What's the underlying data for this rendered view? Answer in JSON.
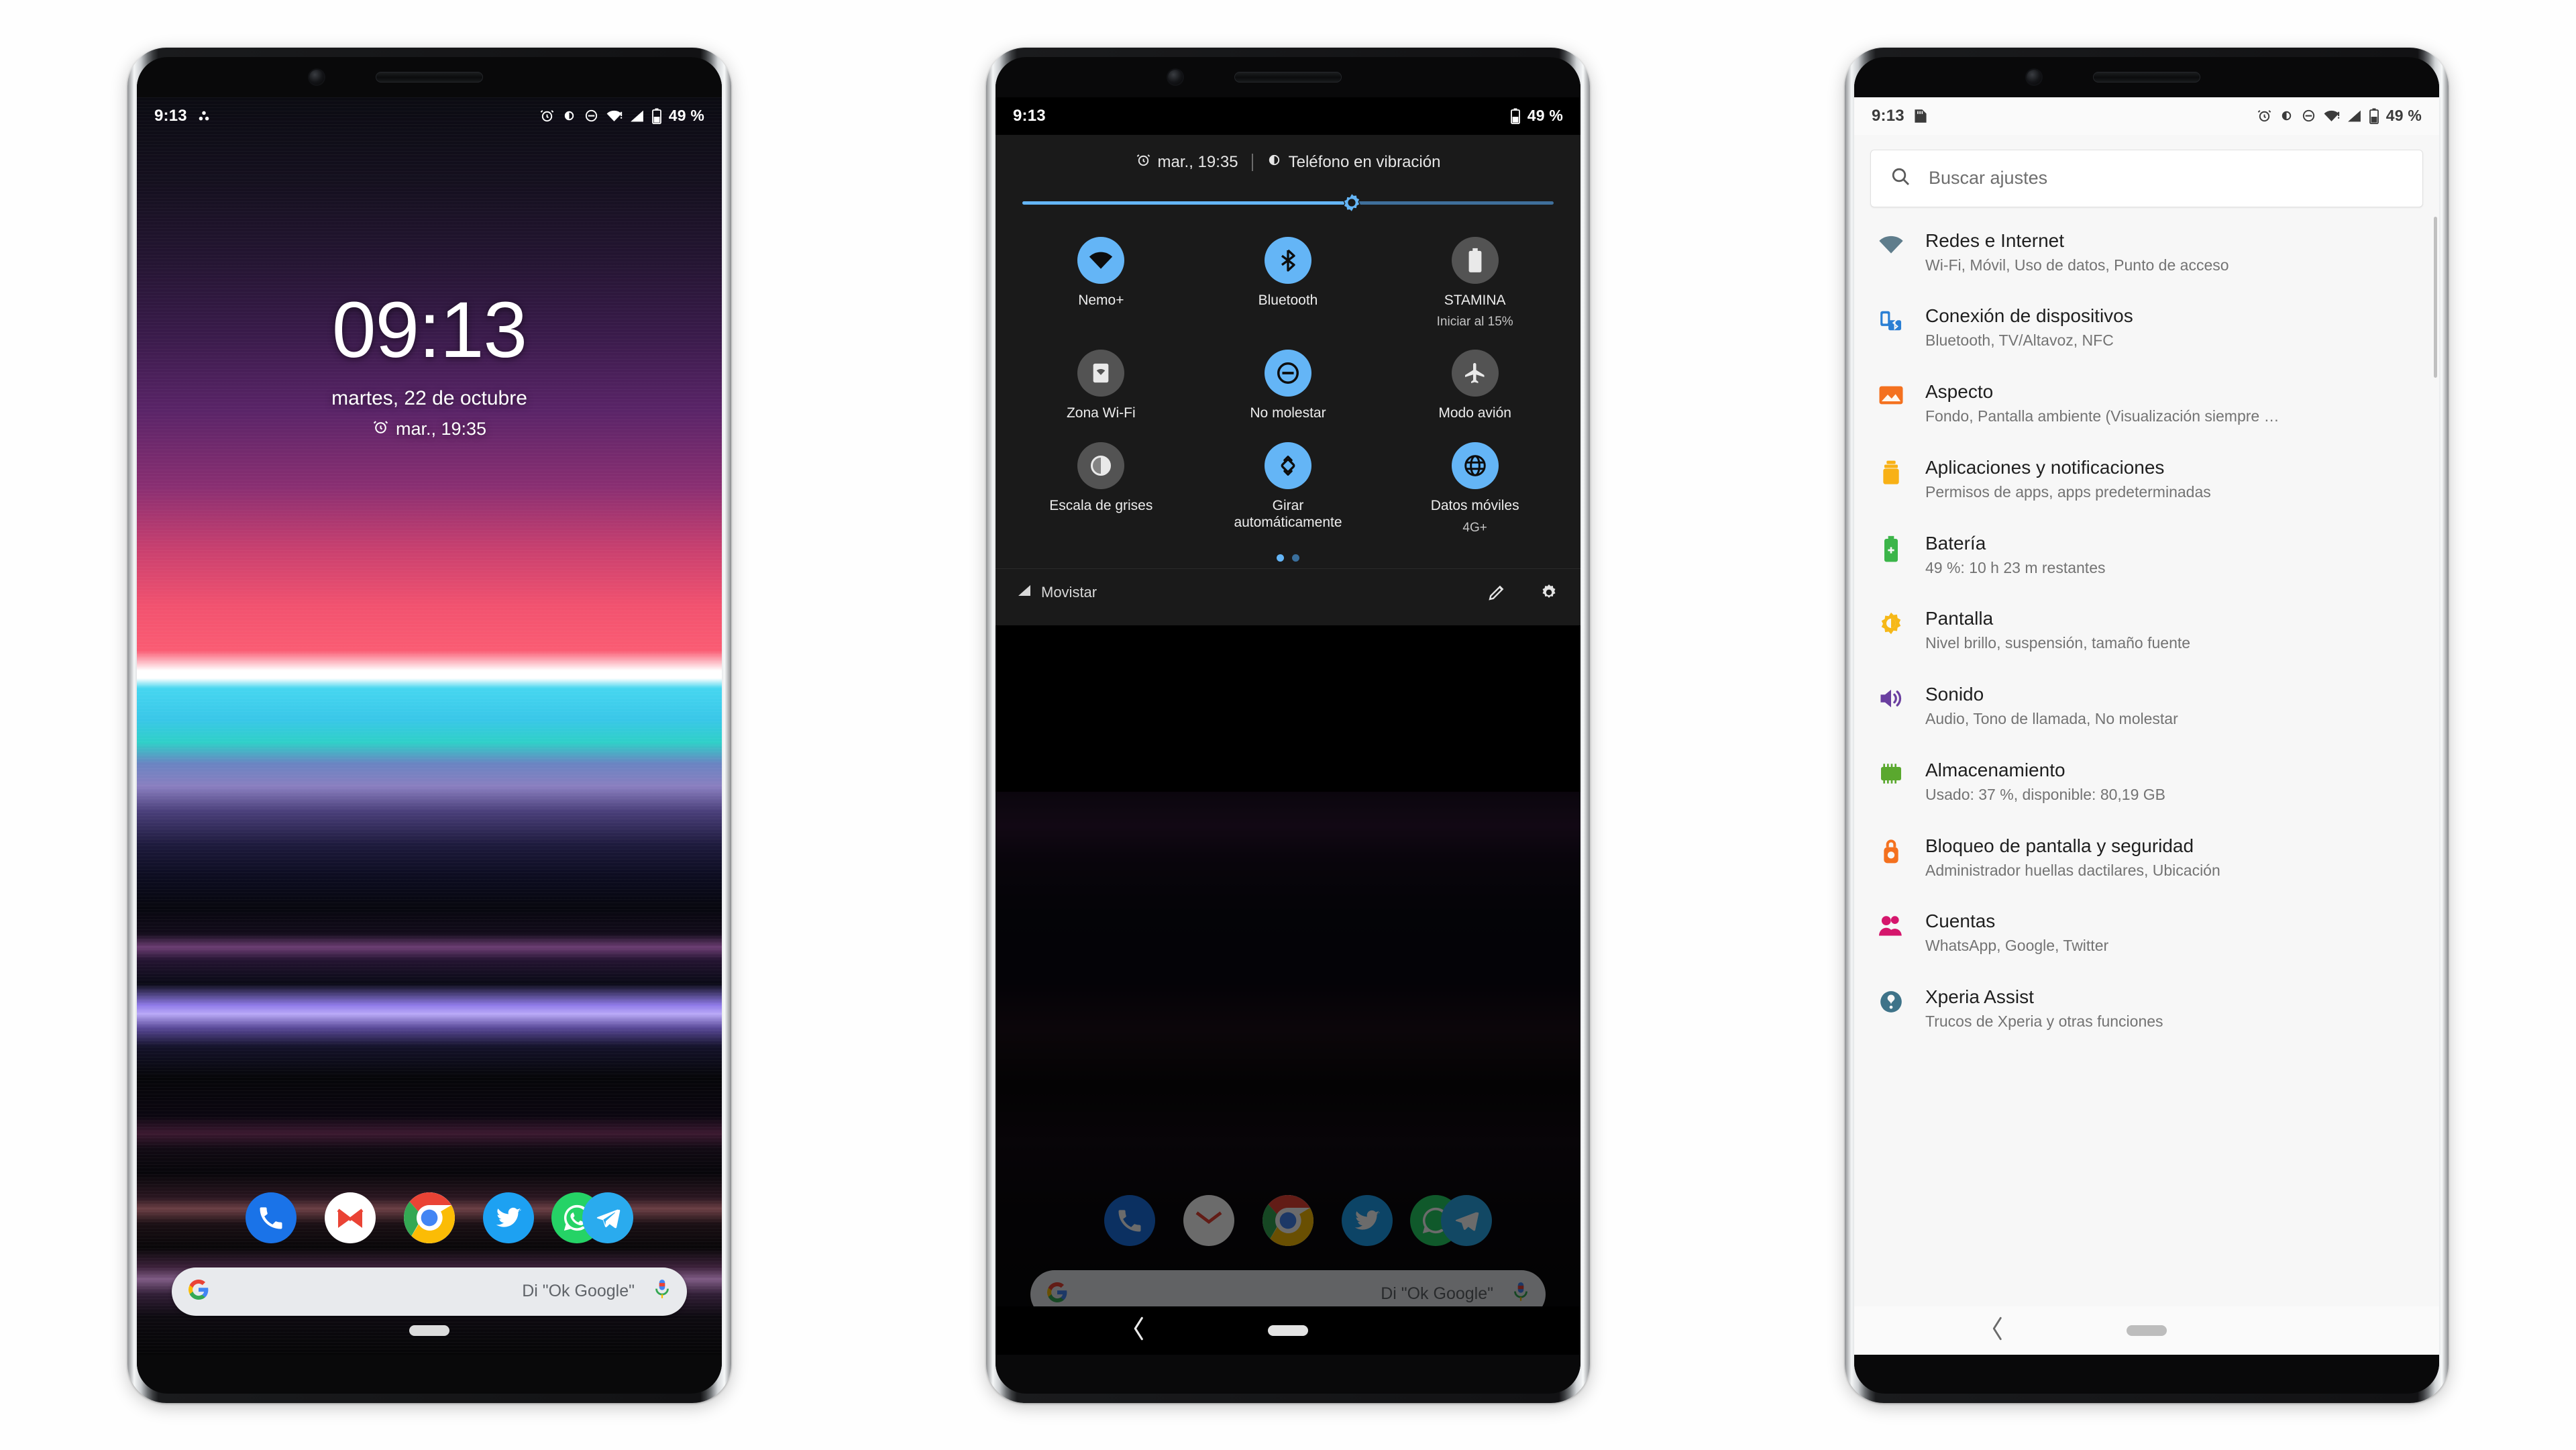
{
  "statusbar": {
    "time": "9:13",
    "battery_pct": "49 %",
    "icons": [
      "alarm-icon",
      "brightness-icon",
      "do-not-disturb-icon",
      "wifi-icon",
      "signal-icon",
      "battery-icon"
    ]
  },
  "phone1": {
    "name": "lock-screen",
    "status_time": "9:13",
    "status_battery": "49 %",
    "clock": "09:13",
    "date": "martes, 22 de octubre",
    "alarm": "mar., 19:35",
    "dock": [
      {
        "name": "phone-app",
        "label": "Teléfono"
      },
      {
        "name": "gmail-app",
        "label": "Gmail"
      },
      {
        "name": "chrome-app",
        "label": "Chrome"
      },
      {
        "name": "twitter-app",
        "label": "Twitter"
      },
      {
        "name": "whatsapp-app",
        "label": "WhatsApp"
      },
      {
        "name": "telegram-app",
        "label": "Telegram"
      }
    ],
    "search_hint": "Di \"Ok Google\""
  },
  "phone2": {
    "name": "quick-settings",
    "status_time": "9:13",
    "status_battery": "49 %",
    "header_alarm": "mar., 19:35",
    "header_ring": "Teléfono en vibración",
    "brightness_pct": 62,
    "tiles": [
      {
        "label": "Nemo+",
        "sub": "",
        "state": "on",
        "icon": "wifi-icon"
      },
      {
        "label": "Bluetooth",
        "sub": "",
        "state": "on",
        "icon": "bluetooth-icon"
      },
      {
        "label": "STAMINA",
        "sub": "Iniciar al 15%",
        "state": "off",
        "icon": "battery-icon"
      },
      {
        "label": "Zona Wi-Fi",
        "sub": "",
        "state": "off",
        "icon": "hotspot-icon"
      },
      {
        "label": "No molestar",
        "sub": "",
        "state": "on",
        "icon": "do-not-disturb-icon"
      },
      {
        "label": "Modo avión",
        "sub": "",
        "state": "off",
        "icon": "airplane-icon"
      },
      {
        "label": "Escala de grises",
        "sub": "",
        "state": "off",
        "icon": "grayscale-icon"
      },
      {
        "label": "Girar automáticamente",
        "sub": "",
        "state": "on",
        "icon": "auto-rotate-icon"
      },
      {
        "label": "Datos móviles",
        "sub": "4G+",
        "state": "on",
        "icon": "globe-icon"
      }
    ],
    "page_dots": {
      "count": 2,
      "active": 0
    },
    "carrier": "Movistar",
    "footer_icons": [
      "edit-pencil-icon",
      "gear-icon"
    ],
    "search_hint": "Di \"Ok Google\""
  },
  "phone3": {
    "name": "settings-app",
    "status_time": "9:13",
    "status_battery": "49 %",
    "search_placeholder": "Buscar ajustes",
    "items": [
      {
        "title": "Redes e Internet",
        "sub": "Wi-Fi, Móvil, Uso de datos, Punto de acceso",
        "icon": "wifi-icon",
        "color": "#5f7d8c"
      },
      {
        "title": "Conexión de dispositivos",
        "sub": "Bluetooth, TV/Altavoz, NFC",
        "icon": "devices-icon",
        "color": "#2a7fd4"
      },
      {
        "title": "Aspecto",
        "sub": "Fondo, Pantalla ambiente (Visualización siempre …",
        "icon": "wallpaper-icon",
        "color": "#f4711f"
      },
      {
        "title": "Aplicaciones y notificaciones",
        "sub": "Permisos de apps, apps predeterminadas",
        "icon": "apps-icon",
        "color": "#f8b116"
      },
      {
        "title": "Batería",
        "sub": "49 %: 10 h  23 m restantes",
        "icon": "battery-icon",
        "color": "#3cb54a"
      },
      {
        "title": "Pantalla",
        "sub": "Nivel brillo, suspensión, tamaño fuente",
        "icon": "brightness-icon",
        "color": "#f6b818"
      },
      {
        "title": "Sonido",
        "sub": "Audio, Tono de llamada, No molestar",
        "icon": "volume-icon",
        "color": "#6a3fa0"
      },
      {
        "title": "Almacenamiento",
        "sub": "Usado: 37 %, disponible: 80,19 GB",
        "icon": "storage-icon",
        "color": "#5aa82e"
      },
      {
        "title": "Bloqueo de pantalla y seguridad",
        "sub": "Administrador huellas dactilares, Ubicación",
        "icon": "lock-icon",
        "color": "#f4711f"
      },
      {
        "title": "Cuentas",
        "sub": "WhatsApp, Google, Twitter",
        "icon": "accounts-icon",
        "color": "#d5166c"
      },
      {
        "title": "Xperia Assist",
        "sub": "Trucos de Xperia y otras funciones",
        "icon": "assist-icon",
        "color": "#3e7389"
      }
    ]
  },
  "colors": {
    "accent_blue": "#64b5f6",
    "tile_off": "#535353",
    "panel_bg": "#1a1a1a",
    "settings_bg": "#f7f7f7"
  }
}
